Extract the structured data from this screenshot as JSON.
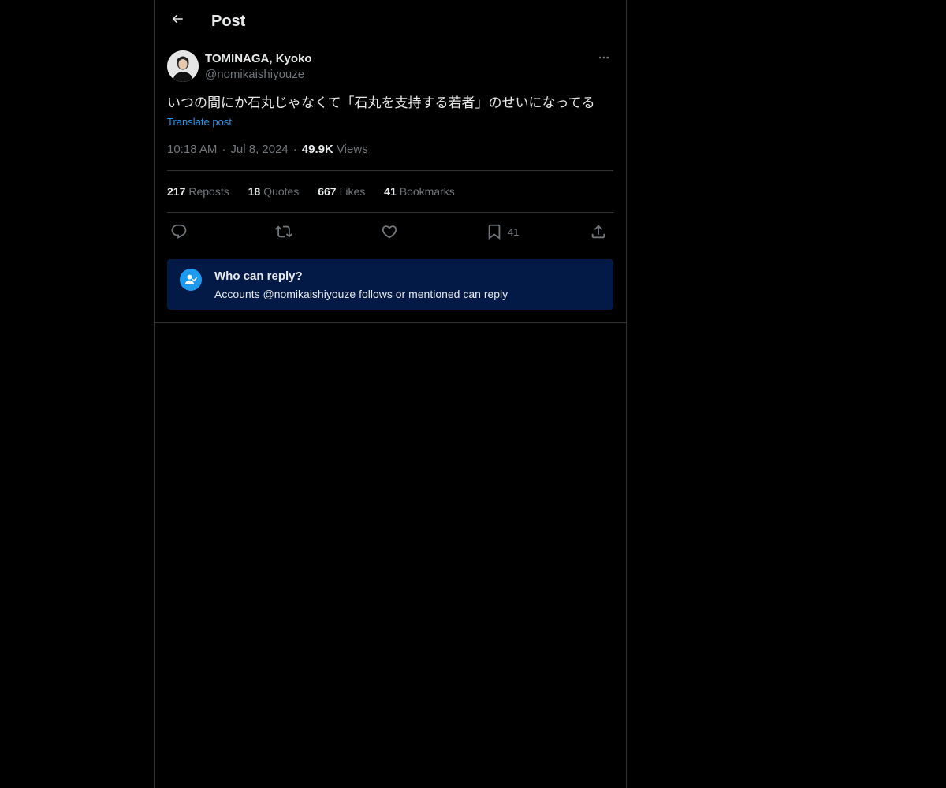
{
  "header": {
    "title": "Post",
    "back_icon": "arrow-left-icon"
  },
  "author": {
    "name": "TOMINAGA, Kyoko",
    "handle": "@nomikaishiyouze"
  },
  "post": {
    "text": "いつの間にか石丸じゃなくて「石丸を支持する若者」のせいになってる",
    "translate_label": "Translate post",
    "time": "10:18 AM",
    "date": "Jul 8, 2024",
    "views_count": "49.9K",
    "views_label": "Views",
    "separator": "·"
  },
  "stats": {
    "reposts_count": "217",
    "reposts_label": "Reposts",
    "quotes_count": "18",
    "quotes_label": "Quotes",
    "likes_count": "667",
    "likes_label": "Likes",
    "bookmarks_count": "41",
    "bookmarks_label": "Bookmarks"
  },
  "actions": {
    "bookmark_count": "41"
  },
  "reply_restriction": {
    "title": "Who can reply?",
    "description": "Accounts @nomikaishiyouze follows or mentioned can reply"
  },
  "colors": {
    "background": "#000000",
    "text": "#e7e9ea",
    "muted": "#71767b",
    "accent": "#1d9bf0",
    "reply_box": "#031a47",
    "border": "#2f3336"
  }
}
